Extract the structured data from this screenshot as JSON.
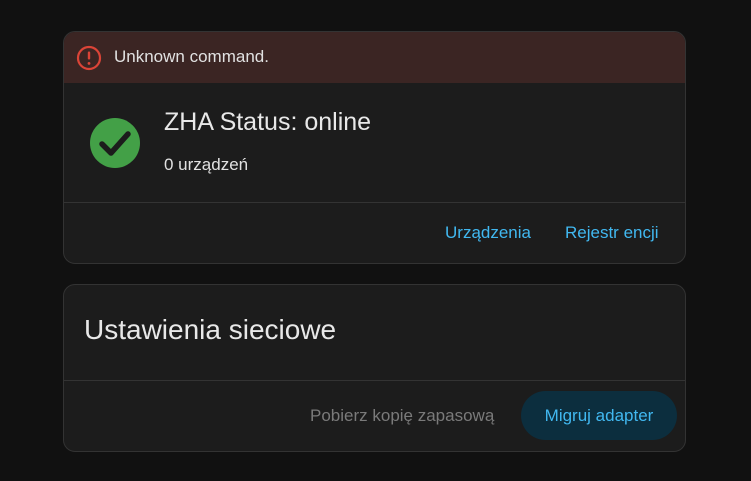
{
  "alert": {
    "icon": "alert-circle-icon",
    "message": "Unknown command.",
    "color": "#db4437"
  },
  "status": {
    "icon": "check-circle-icon",
    "icon_color": "#43a047",
    "title": "ZHA Status: online",
    "device_count": "0 urządzeń"
  },
  "status_actions": {
    "devices_label": "Urządzenia",
    "entities_label": "Rejestr encji"
  },
  "network": {
    "title": "Ustawienia sieciowe",
    "backup_label": "Pobierz kopię zapasową",
    "migrate_label": "Migruj adapter"
  },
  "colors": {
    "accent": "#41b8f0",
    "card_background": "#1c1c1c",
    "page_background": "#111111",
    "alert_background": "#3b2523"
  }
}
